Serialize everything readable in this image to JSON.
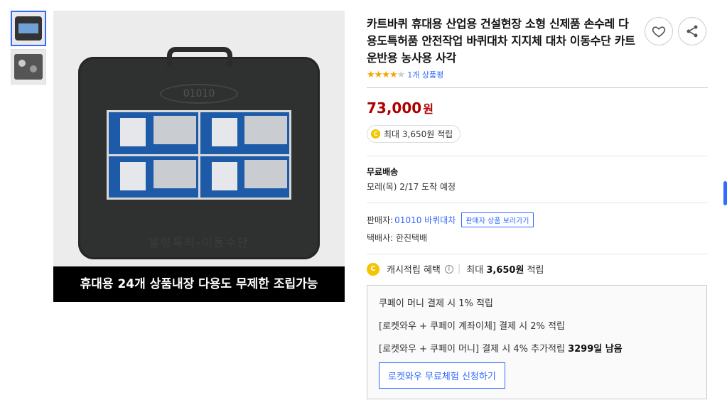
{
  "banner_text": "휴대용 24개 상품내장 다용도 무제한 조립가능",
  "case_logo": "01010",
  "case_emboss": "발명특허-이동수단",
  "title": "카트바퀴 휴대용 산업용 건설현장 소형 신제품 손수레 다용도특허품 안전작업 바퀴대차 지지체 대차 이동수단 카트 운반용 농사용 사각",
  "rating": {
    "stars": 4,
    "max": 5,
    "review_text": "1개 상품평"
  },
  "price": {
    "value": "73,000",
    "unit": "원"
  },
  "reward": {
    "coin_letter": "C",
    "text": "최대 3,650원 적립"
  },
  "shipping": {
    "label": "무료배송",
    "date": "모레(목) 2/17 도착 예정"
  },
  "seller": {
    "label": "판매자:",
    "name": "01010 바퀴대차",
    "button": "판매자 상품 보러가기",
    "courier": "택배사: 한진택배"
  },
  "cash": {
    "label": "캐시적립 혜택",
    "info": "i",
    "max_prefix": "최대",
    "max_amount": "3,650원",
    "max_suffix": "적립"
  },
  "benefits": {
    "line1": "쿠페이 머니 결제 시 1% 적립",
    "line2": "[로켓와우 + 쿠페이 계좌이체] 결제 시 2% 적립",
    "line3_prefix": "[로켓와우 + 쿠페이 머니] 결제 시 4% 추가적립",
    "line3_bold": "3299일 남음",
    "button": "로켓와우 무료체험 신청하기"
  },
  "colors": {
    "accent": "#346aff",
    "price": "#ae0000",
    "star": "#f7a300",
    "coin": "#f5c400"
  }
}
